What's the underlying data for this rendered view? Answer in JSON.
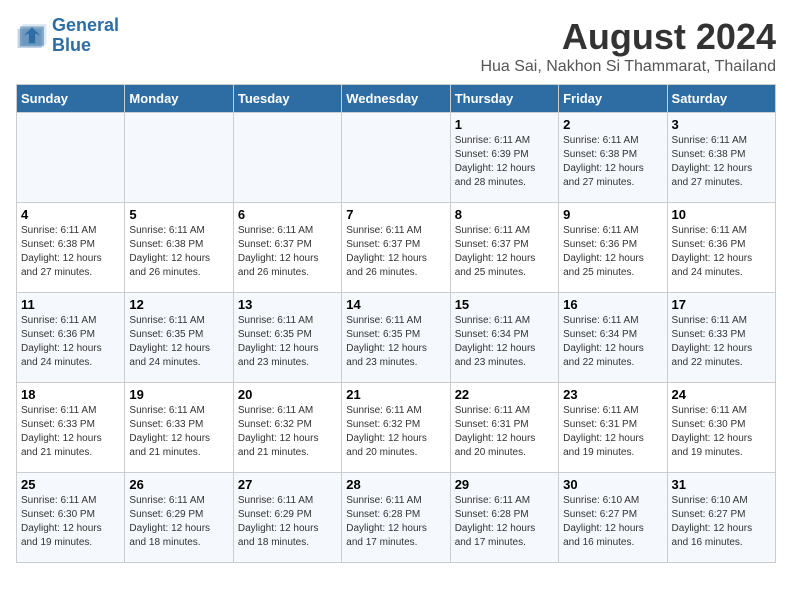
{
  "logo": {
    "line1": "General",
    "line2": "Blue"
  },
  "title": "August 2024",
  "subtitle": "Hua Sai, Nakhon Si Thammarat, Thailand",
  "days_of_week": [
    "Sunday",
    "Monday",
    "Tuesday",
    "Wednesday",
    "Thursday",
    "Friday",
    "Saturday"
  ],
  "weeks": [
    [
      {
        "day": "",
        "info": ""
      },
      {
        "day": "",
        "info": ""
      },
      {
        "day": "",
        "info": ""
      },
      {
        "day": "",
        "info": ""
      },
      {
        "day": "1",
        "info": "Sunrise: 6:11 AM\nSunset: 6:39 PM\nDaylight: 12 hours\nand 28 minutes."
      },
      {
        "day": "2",
        "info": "Sunrise: 6:11 AM\nSunset: 6:38 PM\nDaylight: 12 hours\nand 27 minutes."
      },
      {
        "day": "3",
        "info": "Sunrise: 6:11 AM\nSunset: 6:38 PM\nDaylight: 12 hours\nand 27 minutes."
      }
    ],
    [
      {
        "day": "4",
        "info": "Sunrise: 6:11 AM\nSunset: 6:38 PM\nDaylight: 12 hours\nand 27 minutes."
      },
      {
        "day": "5",
        "info": "Sunrise: 6:11 AM\nSunset: 6:38 PM\nDaylight: 12 hours\nand 26 minutes."
      },
      {
        "day": "6",
        "info": "Sunrise: 6:11 AM\nSunset: 6:37 PM\nDaylight: 12 hours\nand 26 minutes."
      },
      {
        "day": "7",
        "info": "Sunrise: 6:11 AM\nSunset: 6:37 PM\nDaylight: 12 hours\nand 26 minutes."
      },
      {
        "day": "8",
        "info": "Sunrise: 6:11 AM\nSunset: 6:37 PM\nDaylight: 12 hours\nand 25 minutes."
      },
      {
        "day": "9",
        "info": "Sunrise: 6:11 AM\nSunset: 6:36 PM\nDaylight: 12 hours\nand 25 minutes."
      },
      {
        "day": "10",
        "info": "Sunrise: 6:11 AM\nSunset: 6:36 PM\nDaylight: 12 hours\nand 24 minutes."
      }
    ],
    [
      {
        "day": "11",
        "info": "Sunrise: 6:11 AM\nSunset: 6:36 PM\nDaylight: 12 hours\nand 24 minutes."
      },
      {
        "day": "12",
        "info": "Sunrise: 6:11 AM\nSunset: 6:35 PM\nDaylight: 12 hours\nand 24 minutes."
      },
      {
        "day": "13",
        "info": "Sunrise: 6:11 AM\nSunset: 6:35 PM\nDaylight: 12 hours\nand 23 minutes."
      },
      {
        "day": "14",
        "info": "Sunrise: 6:11 AM\nSunset: 6:35 PM\nDaylight: 12 hours\nand 23 minutes."
      },
      {
        "day": "15",
        "info": "Sunrise: 6:11 AM\nSunset: 6:34 PM\nDaylight: 12 hours\nand 23 minutes."
      },
      {
        "day": "16",
        "info": "Sunrise: 6:11 AM\nSunset: 6:34 PM\nDaylight: 12 hours\nand 22 minutes."
      },
      {
        "day": "17",
        "info": "Sunrise: 6:11 AM\nSunset: 6:33 PM\nDaylight: 12 hours\nand 22 minutes."
      }
    ],
    [
      {
        "day": "18",
        "info": "Sunrise: 6:11 AM\nSunset: 6:33 PM\nDaylight: 12 hours\nand 21 minutes."
      },
      {
        "day": "19",
        "info": "Sunrise: 6:11 AM\nSunset: 6:33 PM\nDaylight: 12 hours\nand 21 minutes."
      },
      {
        "day": "20",
        "info": "Sunrise: 6:11 AM\nSunset: 6:32 PM\nDaylight: 12 hours\nand 21 minutes."
      },
      {
        "day": "21",
        "info": "Sunrise: 6:11 AM\nSunset: 6:32 PM\nDaylight: 12 hours\nand 20 minutes."
      },
      {
        "day": "22",
        "info": "Sunrise: 6:11 AM\nSunset: 6:31 PM\nDaylight: 12 hours\nand 20 minutes."
      },
      {
        "day": "23",
        "info": "Sunrise: 6:11 AM\nSunset: 6:31 PM\nDaylight: 12 hours\nand 19 minutes."
      },
      {
        "day": "24",
        "info": "Sunrise: 6:11 AM\nSunset: 6:30 PM\nDaylight: 12 hours\nand 19 minutes."
      }
    ],
    [
      {
        "day": "25",
        "info": "Sunrise: 6:11 AM\nSunset: 6:30 PM\nDaylight: 12 hours\nand 19 minutes."
      },
      {
        "day": "26",
        "info": "Sunrise: 6:11 AM\nSunset: 6:29 PM\nDaylight: 12 hours\nand 18 minutes."
      },
      {
        "day": "27",
        "info": "Sunrise: 6:11 AM\nSunset: 6:29 PM\nDaylight: 12 hours\nand 18 minutes."
      },
      {
        "day": "28",
        "info": "Sunrise: 6:11 AM\nSunset: 6:28 PM\nDaylight: 12 hours\nand 17 minutes."
      },
      {
        "day": "29",
        "info": "Sunrise: 6:11 AM\nSunset: 6:28 PM\nDaylight: 12 hours\nand 17 minutes."
      },
      {
        "day": "30",
        "info": "Sunrise: 6:10 AM\nSunset: 6:27 PM\nDaylight: 12 hours\nand 16 minutes."
      },
      {
        "day": "31",
        "info": "Sunrise: 6:10 AM\nSunset: 6:27 PM\nDaylight: 12 hours\nand 16 minutes."
      }
    ]
  ]
}
